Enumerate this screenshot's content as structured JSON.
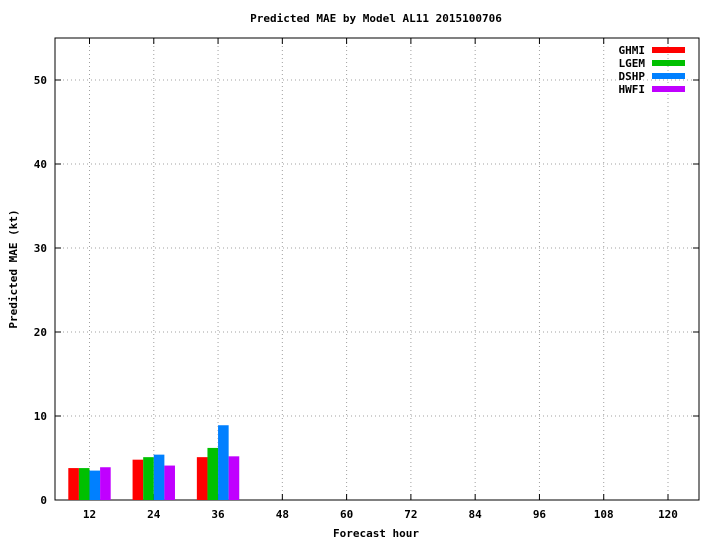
{
  "chart_data": {
    "type": "bar",
    "title": "Predicted MAE by Model  AL11 2015100706",
    "xlabel": "Forecast hour",
    "ylabel": "Predicted MAE (kt)",
    "ylim": [
      0,
      55
    ],
    "yticks": [
      "0",
      "10",
      "20",
      "30",
      "40",
      "50"
    ],
    "categories": [
      "12",
      "24",
      "36",
      "48",
      "60",
      "72",
      "84",
      "96",
      "108",
      "120"
    ],
    "grid": true,
    "legend": "top-right",
    "series": [
      {
        "name": "GHMI",
        "color": "#ff0000",
        "values": [
          3.8,
          4.8,
          5.1,
          null,
          null,
          null,
          null,
          null,
          null,
          null
        ]
      },
      {
        "name": "LGEM",
        "color": "#00c000",
        "values": [
          3.8,
          5.1,
          6.2,
          null,
          null,
          null,
          null,
          null,
          null,
          null
        ]
      },
      {
        "name": "DSHP",
        "color": "#0080ff",
        "values": [
          3.5,
          5.4,
          8.9,
          null,
          null,
          null,
          null,
          null,
          null,
          null
        ]
      },
      {
        "name": "HWFI",
        "color": "#c000ff",
        "values": [
          3.9,
          4.1,
          5.2,
          null,
          null,
          null,
          null,
          null,
          null,
          null
        ]
      }
    ]
  }
}
